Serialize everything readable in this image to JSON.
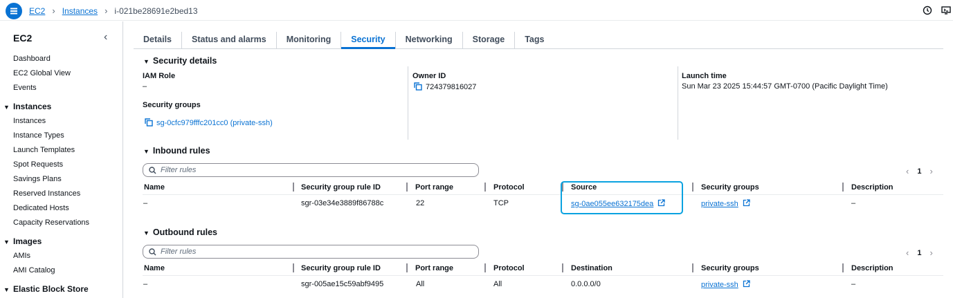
{
  "breadcrumb": {
    "root": "EC2",
    "section": "Instances",
    "current": "i-021be28691e2bed13"
  },
  "sidebar": {
    "title": "EC2",
    "top_items": [
      "Dashboard",
      "EC2 Global View",
      "Events"
    ],
    "instances_section": "Instances",
    "instances_items": [
      "Instances",
      "Instance Types",
      "Launch Templates",
      "Spot Requests",
      "Savings Plans",
      "Reserved Instances",
      "Dedicated Hosts",
      "Capacity Reservations"
    ],
    "images_section": "Images",
    "images_items": [
      "AMIs",
      "AMI Catalog"
    ],
    "ebs_section": "Elastic Block Store"
  },
  "tabs": [
    "Details",
    "Status and alarms",
    "Monitoring",
    "Security",
    "Networking",
    "Storage",
    "Tags"
  ],
  "active_tab": "Security",
  "security_details": {
    "heading": "Security details",
    "iam_role_label": "IAM Role",
    "iam_role_value": "–",
    "owner_id_label": "Owner ID",
    "owner_id_value": "724379816027",
    "launch_time_label": "Launch time",
    "launch_time_value": "Sun Mar 23 2025 15:44:57 GMT-0700 (Pacific Daylight Time)",
    "security_groups_label": "Security groups",
    "security_groups_value": "sg-0cfc979fffc201cc0 (private-ssh)"
  },
  "inbound": {
    "heading": "Inbound rules",
    "filter_placeholder": "Filter rules",
    "page": "1",
    "columns": [
      "Name",
      "Security group rule ID",
      "Port range",
      "Protocol",
      "Source",
      "Security groups",
      "Description"
    ],
    "row": {
      "name": "–",
      "rule_id": "sgr-03e34e3889f86788c",
      "port_range": "22",
      "protocol": "TCP",
      "source": "sg-0ae055ee632175dea",
      "security_group": "private-ssh",
      "description": "–"
    }
  },
  "outbound": {
    "heading": "Outbound rules",
    "filter_placeholder": "Filter rules",
    "page": "1",
    "columns": [
      "Name",
      "Security group rule ID",
      "Port range",
      "Protocol",
      "Destination",
      "Security groups",
      "Description"
    ],
    "row": {
      "name": "–",
      "rule_id": "sgr-005ae15c59abf9495",
      "port_range": "All",
      "protocol": "All",
      "destination": "0.0.0.0/0",
      "security_group": "private-ssh",
      "description": "–"
    }
  },
  "colors": {
    "accent": "#0972d3",
    "highlight": "#0aa2e0",
    "text": "#0f141a"
  },
  "icons": [
    "menu-icon",
    "chevron-right-icon",
    "notifications-icon",
    "cloudshell-icon",
    "close-sidebar-icon",
    "caret-down-icon",
    "copy-icon",
    "search-icon",
    "chevron-left-icon",
    "external-link-icon"
  ]
}
